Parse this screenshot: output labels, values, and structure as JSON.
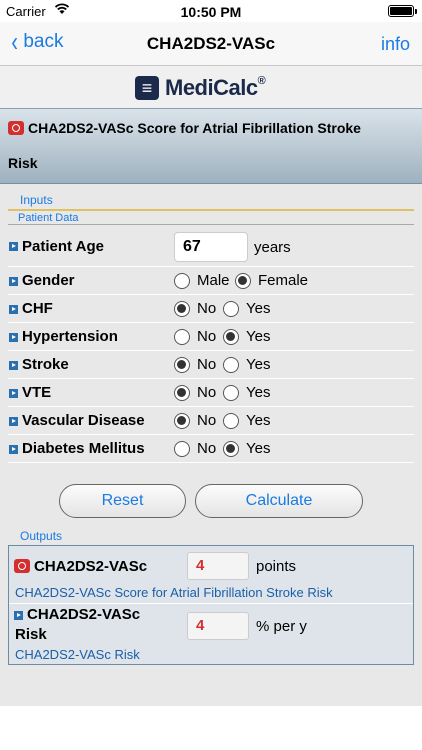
{
  "status": {
    "carrier": "Carrier",
    "time": "10:50 PM"
  },
  "nav": {
    "back_label": "back",
    "title": "CHA2DS2-VASc",
    "info_label": "info"
  },
  "brand": {
    "logo_text": "MediCalc",
    "reg_mark": "®"
  },
  "calc_title": {
    "line1": "CHA2DS2-VASc Score for Atrial Fibrillation Stroke",
    "line2": "Risk"
  },
  "inputs": {
    "section_label": "Inputs",
    "subhead": "Patient Data",
    "age": {
      "label": "Patient Age",
      "value": "67",
      "unit": "years"
    },
    "gender": {
      "label": "Gender",
      "opt1": "Male",
      "opt2": "Female",
      "selected": "Female"
    },
    "rows": [
      {
        "label": "CHF",
        "no": "No",
        "yes": "Yes",
        "selected": "No"
      },
      {
        "label": "Hypertension",
        "no": "No",
        "yes": "Yes",
        "selected": "Yes"
      },
      {
        "label": "Stroke",
        "no": "No",
        "yes": "Yes",
        "selected": "No"
      },
      {
        "label": "VTE",
        "no": "No",
        "yes": "Yes",
        "selected": "No"
      },
      {
        "label": "Vascular Disease",
        "no": "No",
        "yes": "Yes",
        "selected": "No"
      },
      {
        "label": "Diabetes Mellitus",
        "no": "No",
        "yes": "Yes",
        "selected": "Yes"
      }
    ]
  },
  "buttons": {
    "reset": "Reset",
    "calculate": "Calculate"
  },
  "outputs": {
    "section_label": "Outputs",
    "score": {
      "name": "CHA2DS2-VASc",
      "value": "4",
      "unit": "points",
      "desc": "CHA2DS2-VASc Score for Atrial Fibrillation Stroke Risk"
    },
    "risk": {
      "name_line1": "CHA2DS2-VASc",
      "name_line2": "Risk",
      "value": "4",
      "unit": "% per y",
      "desc": "CHA2DS2-VASc Risk"
    }
  },
  "colors": {
    "accent": "#1a7be2",
    "alert": "#d42f2f",
    "brand": "#1b2a4a"
  }
}
